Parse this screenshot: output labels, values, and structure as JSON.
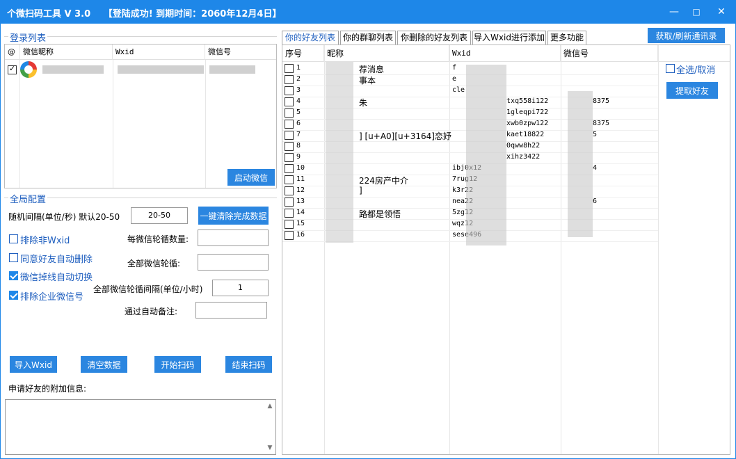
{
  "window": {
    "title": "个微扫码工具 V 3.0",
    "status": "【登陆成功! 到期时间：2060年12月4日】",
    "minimize": "—",
    "maximize": "□",
    "close": "✕"
  },
  "login": {
    "group_title": "登录列表",
    "columns": [
      "@",
      "微信昵称",
      "Wxid",
      "微信号"
    ],
    "start_button": "启动微信"
  },
  "config": {
    "group_title": "全局配置",
    "interval_label": "随机间隔(单位/秒) 默认20-50",
    "interval_value": "20-50",
    "clear_done_button": "一键清除完成数据",
    "exclude_non_wxid": "排除非Wxid",
    "per_rotation_label": "每微信轮循数量:",
    "auto_delete": "同意好友自动删除",
    "all_rotation_label": "全部微信轮循:",
    "auto_switch": "微信掉线自动切换",
    "rotation_interval_label": "全部微信轮循间隔(单位/小时)",
    "rotation_interval_value": "1",
    "exclude_enterprise": "排除企业微信号",
    "auto_remark_label": "通过自动备注:",
    "import_button": "导入Wxid",
    "clear_button": "清空数据",
    "start_scan_button": "开始扫码",
    "stop_scan_button": "结束扫码",
    "extra_info_label": "申请好友的附加信息:"
  },
  "tabs": [
    "你的好友列表",
    "你的群聊列表",
    "你删除的好友列表",
    "导入Wxid进行添加",
    "更多功能"
  ],
  "refresh_button": "获取/刷新通讯录",
  "select_all": "全选/取消",
  "extract_button": "提取好友",
  "friends": {
    "columns": [
      "序号",
      "昵称",
      "Wxid",
      "微信号"
    ],
    "rows": [
      {
        "n": "1",
        "nick": "荐消息",
        "wxid": "f",
        "wxh": ""
      },
      {
        "n": "2",
        "nick": "事本",
        "wxid": "e",
        "wxh": ""
      },
      {
        "n": "3",
        "nick": "",
        "wxid": "cle",
        "wxh": ""
      },
      {
        "n": "4",
        "nick": "朱",
        "wxid": "txq558i122",
        "wxh": "8375"
      },
      {
        "n": "5",
        "nick": "",
        "wxid": "1gleqpi722",
        "wxh": ""
      },
      {
        "n": "6",
        "nick": "",
        "wxid": "xwb0zpw122",
        "wxh": "8375"
      },
      {
        "n": "7",
        "nick": "] [u+A0][u+3164]恋妤",
        "wxid": "kaet18822",
        "wxh": "5"
      },
      {
        "n": "8",
        "nick": "",
        "wxid": "0qww8h22",
        "wxh": ""
      },
      {
        "n": "9",
        "nick": "",
        "wxid": "xihz3422",
        "wxh": ""
      },
      {
        "n": "10",
        "nick": "",
        "wxid": "ibj0x12",
        "wxh": "4"
      },
      {
        "n": "11",
        "nick": "224房产中介",
        "wxid": "7rug12",
        "wxh": ""
      },
      {
        "n": "12",
        "nick": "]",
        "wxid": "k3r22",
        "wxh": ""
      },
      {
        "n": "13",
        "nick": "",
        "wxid": "nea22",
        "wxh": "6"
      },
      {
        "n": "14",
        "nick": "路都是领悟",
        "wxid": "5zg12",
        "wxh": ""
      },
      {
        "n": "15",
        "nick": "",
        "wxid": "wqz12",
        "wxh": ""
      },
      {
        "n": "16",
        "nick": "",
        "wxid": "sese496",
        "wxh": ""
      }
    ]
  }
}
